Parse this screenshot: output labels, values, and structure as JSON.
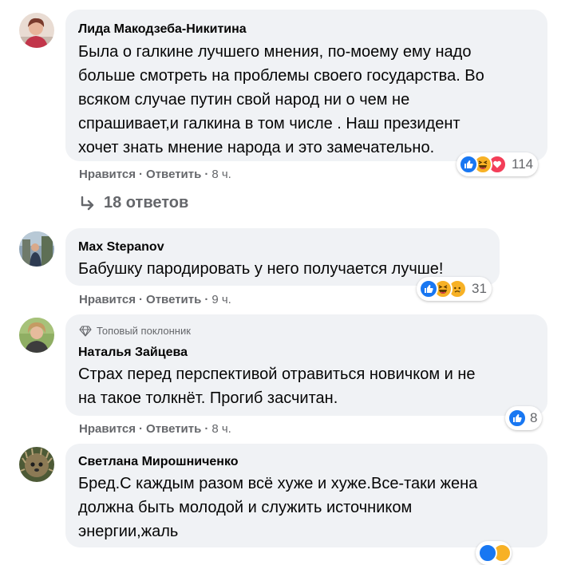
{
  "colors": {
    "bubble": "#f0f2f5",
    "secondary_text": "#65676b",
    "like_blue": "#1877f2",
    "love_red": "#f33e58",
    "emoji_yellow": "#f7b125"
  },
  "actions": {
    "like": "Нравится",
    "reply": "Ответить",
    "separator": "·"
  },
  "comments": [
    {
      "author": "Лида Макодзеба-Никитина",
      "lines": [
        "Была о галкине лучшего мнения, по-моему ему надо",
        "больше смотреть на проблемы своего государства. Во",
        "всяком случае путин свой народ ни о чем не",
        "спрашивает,и галкина в том числе . Наш президент",
        "хочет знать мнение народа и это замечательно."
      ],
      "time": "8 ч.",
      "reaction_icons": [
        "like-icon",
        "haha-icon",
        "love-icon"
      ],
      "reaction_count": "114"
    },
    {
      "author": "Max Stepanov",
      "lines": [
        "Бабушку пародировать у него получается лучше!"
      ],
      "time": "9 ч.",
      "reaction_icons": [
        "like-icon",
        "haha-icon",
        "sad-icon"
      ],
      "reaction_count": "31"
    },
    {
      "badge": "Топовый поклонник",
      "author": "Наталья Зайцева",
      "lines": [
        "Страх перед перспективой отравиться новичком и не",
        "на такое толкнёт. Прогиб засчитан."
      ],
      "time": "8 ч.",
      "reaction_icons": [
        "like-icon"
      ],
      "reaction_count": "8"
    },
    {
      "author": "Светлана Мирошниченко",
      "lines": [
        "Бред.С каждым разом всё хуже и хуже.Все-таки жена",
        "должна быть молодой и служить источником",
        "энергии,жаль"
      ]
    }
  ],
  "replies_link": "18 ответов"
}
